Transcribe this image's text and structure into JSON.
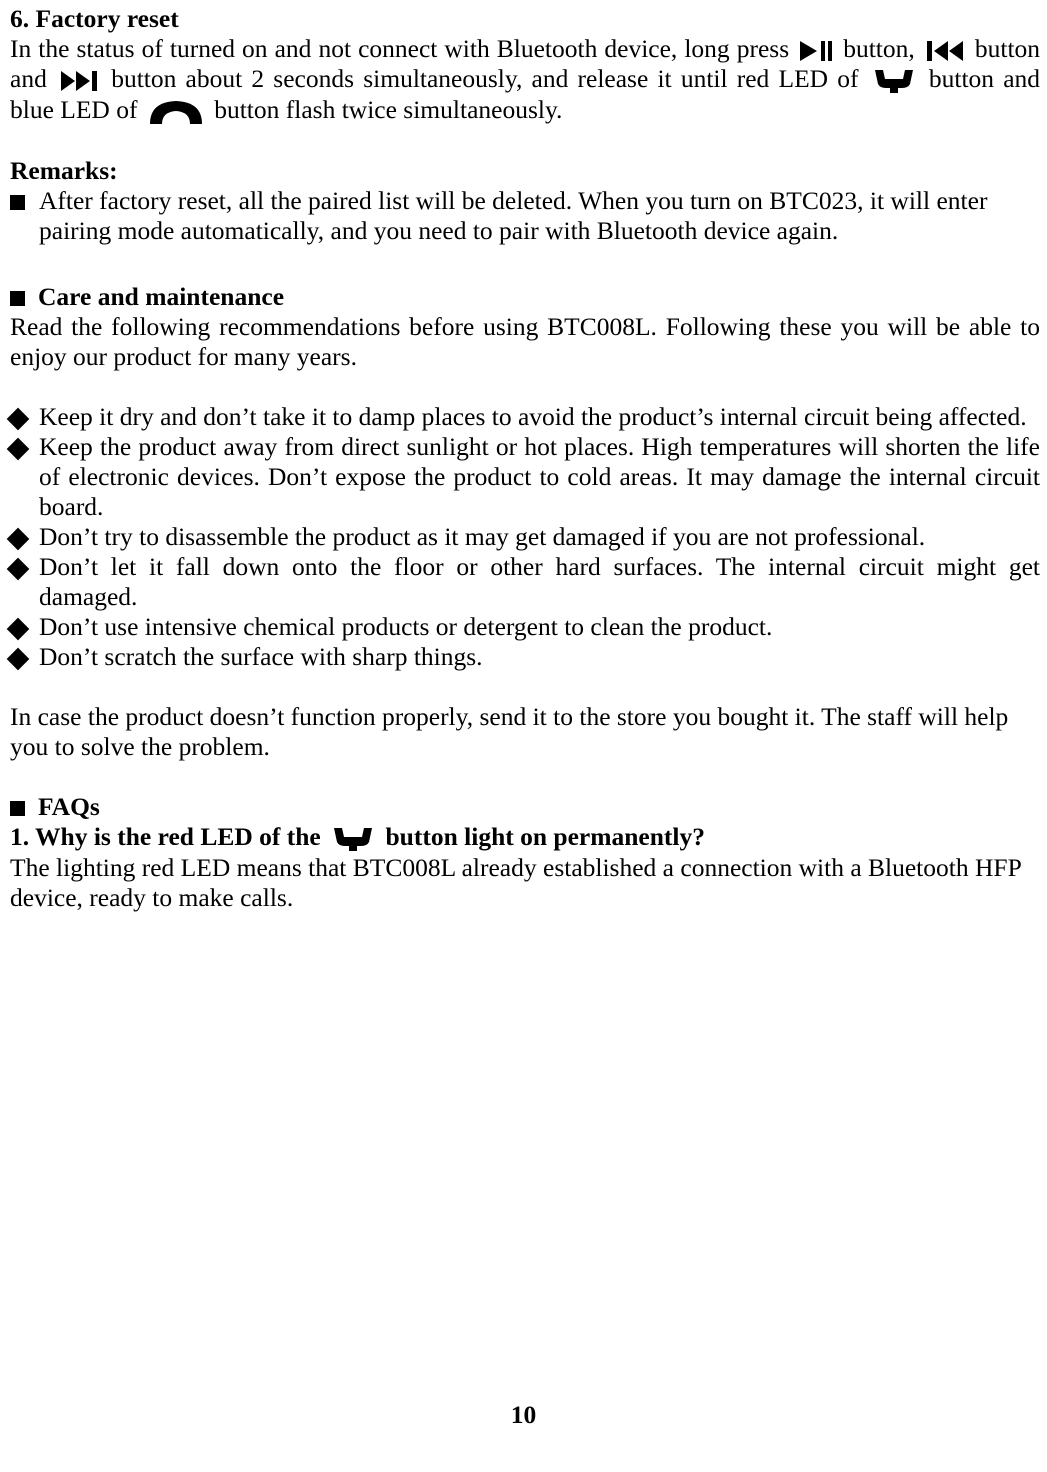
{
  "document": {
    "page_number": "10",
    "sections": {
      "factory_reset": {
        "heading": "6. Factory reset",
        "paragraph_parts": {
          "p1": "In the status of turned on and not connect with Bluetooth device, long press",
          "p2": "button,",
          "p3": "button and",
          "p4": "button about 2 seconds simultaneously, and release it until red LED of",
          "p5": "button and blue LED of",
          "p6": "button flash twice simultaneously."
        }
      },
      "remarks": {
        "heading": "Remarks:",
        "items": [
          "After factory reset, all the paired list will be deleted. When you turn on BTC023, it will enter pairing mode automatically, and you need to pair with Bluetooth device again."
        ]
      },
      "care": {
        "heading": "Care and maintenance",
        "intro": "Read the following recommendations before using BTC008L. Following these you will be able to enjoy our product for many years.",
        "items": [
          "Keep it dry and don’t take it to damp places to avoid the product’s internal circuit being affected.",
          "Keep the product away from direct sunlight or hot places. High temperatures will shorten the life of electronic devices. Don’t expose the product to cold areas. It may damage the internal circuit board.",
          "Don’t try to disassemble the product as it may get damaged if you are not professional.",
          "Don’t let it fall down onto the floor or other hard surfaces. The internal circuit might get damaged.",
          "Don’t use intensive chemical products or detergent to clean the product.",
          "Don’t scratch the surface with sharp things."
        ],
        "closing": "In case the product doesn’t function properly, send it to the store you bought it. The staff will help you to solve the problem."
      },
      "faqs": {
        "heading": "FAQs",
        "q1_part1": "1.  Why is the red LED of the",
        "q1_part2": "button light on permanently?",
        "a1": "The lighting red LED means that BTC008L already established a connection with a Bluetooth HFP device, ready to make calls."
      }
    },
    "icons": {
      "play_pause": "play-pause-icon",
      "previous_track": "previous-track-icon",
      "next_track": "next-track-icon",
      "hook_multifunction": "hook-button-icon",
      "phone_handset": "phone-handset-icon"
    }
  }
}
